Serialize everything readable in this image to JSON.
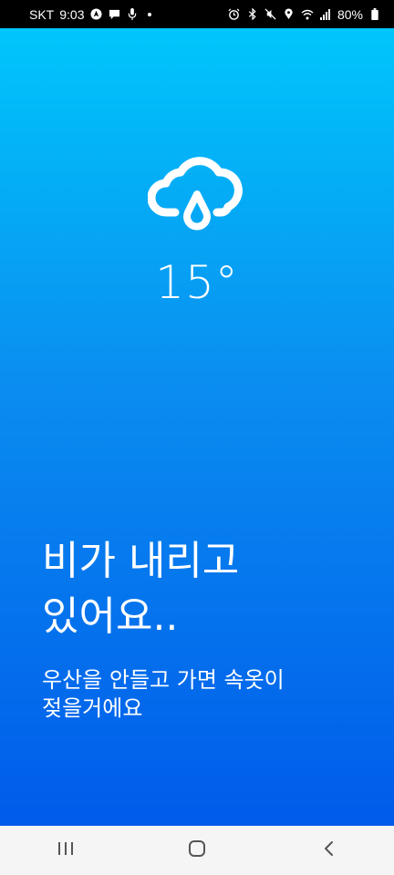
{
  "status_bar": {
    "carrier": "SKT",
    "time": "9:03",
    "battery": "80%",
    "left_icons": [
      "navigation-arrow-icon",
      "chat-bubble-icon",
      "microphone-icon",
      "notification-dot-icon"
    ],
    "right_icons": [
      "alarm-icon",
      "bluetooth-icon",
      "mute-icon",
      "location-icon",
      "wifi-icon",
      "signal-icon",
      "battery-icon"
    ]
  },
  "weather": {
    "condition_icon": "rain-cloud-icon",
    "temperature": "15°",
    "headline_line1": "비가 내리고",
    "headline_line2": "있어요..",
    "subtitle_line1": "우산을 안들고 가면 속옷이",
    "subtitle_line2": "젖을거에요"
  },
  "nav_bar": {
    "buttons": [
      "recent-apps-icon",
      "home-icon",
      "back-icon"
    ]
  },
  "colors": {
    "gradient_top": "#00c6fb",
    "gradient_bottom": "#005bea",
    "text": "#ffffff"
  }
}
